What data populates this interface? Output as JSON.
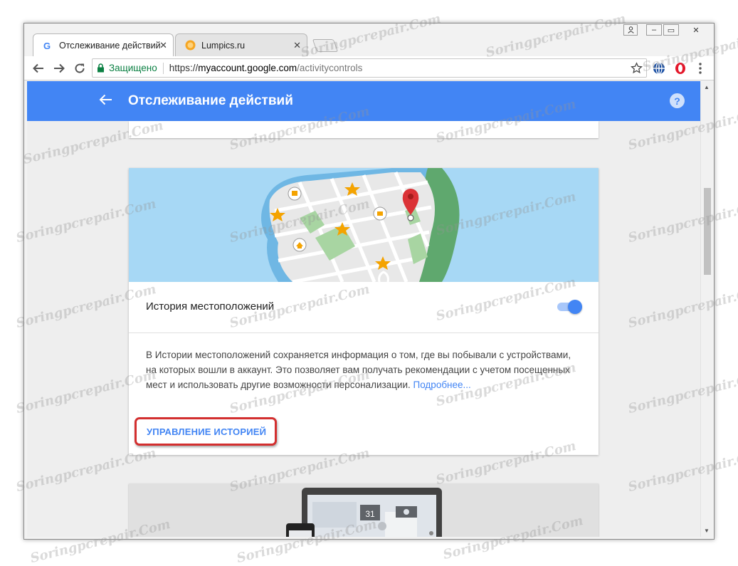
{
  "tabs": [
    {
      "title": "Отслеживание действий",
      "favicon": "google-g-icon",
      "active": true,
      "close": "✕"
    },
    {
      "title": "Lumpics.ru",
      "favicon": "lumpics-orange-icon",
      "active": false,
      "close": "✕"
    }
  ],
  "window_controls": {
    "user": "user-icon",
    "minimize": "–",
    "maximize": "▭",
    "close": "✕"
  },
  "toolbar": {
    "secure_label": "Защищено",
    "url_scheme": "https://",
    "url_host": "myaccount.google.com",
    "url_path": "/activitycontrols"
  },
  "appbar": {
    "title": "Отслеживание действий",
    "help": "?"
  },
  "location_card": {
    "setting_label": "История местоположений",
    "toggle_on": true,
    "description": "В Истории местоположений сохраняется информация о том, где вы побывали с устройствами, на которых вошли в аккаунт. Это позволяет вам получать рекомендации с учетом посещенных мест и использовать другие возможности персонализации.",
    "learn_more": "Подробнее...",
    "manage_button": "УПРАВЛЕНИЕ ИСТОРИЕЙ"
  },
  "device_card": {
    "calendar_day": "31"
  },
  "watermark": "Soringpcrepair.Com",
  "colors": {
    "accent": "#4285f4",
    "highlight": "#d32f2f",
    "map_water": "#a7d8f5",
    "map_park": "#a8d5a2"
  }
}
